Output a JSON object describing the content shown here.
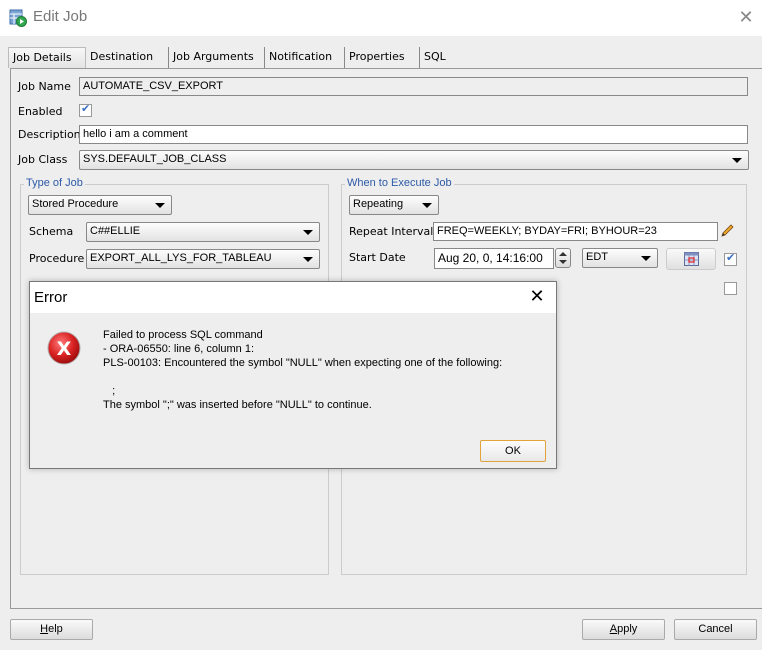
{
  "window": {
    "title": "Edit Job",
    "app_icon": "job-scheduler-icon",
    "close_icon": "close-icon"
  },
  "tabs": [
    {
      "label": "Job Details",
      "active": true
    },
    {
      "label": "Destination",
      "active": false
    },
    {
      "label": "Job Arguments",
      "active": false
    },
    {
      "label": "Notification",
      "active": false
    },
    {
      "label": "Properties",
      "active": false
    },
    {
      "label": "SQL",
      "active": false
    }
  ],
  "job_details": {
    "job_name_label": "Job Name",
    "job_name_value": "AUTOMATE_CSV_EXPORT",
    "enabled_label": "Enabled",
    "enabled_checked": true,
    "description_label": "Description",
    "description_value": "hello i am a comment",
    "job_class_label": "Job Class",
    "job_class_value": "SYS.DEFAULT_JOB_CLASS"
  },
  "type_of_job": {
    "title": "Type of Job",
    "type_value": "Stored Procedure",
    "schema_label": "Schema",
    "schema_value": "C##ELLIE",
    "procedure_label": "Procedure",
    "procedure_value": "EXPORT_ALL_LYS_FOR_TABLEAU"
  },
  "when_to_execute": {
    "title": "When to Execute Job",
    "mode_value": "Repeating",
    "repeat_interval_label": "Repeat Interval",
    "repeat_interval_value": "FREQ=WEEKLY; BYDAY=FRI; BYHOUR=23",
    "start_date_label": "Start Date",
    "start_date_value": "Aug 20, 0, 14:16:00",
    "timezone_value": "EDT",
    "start_date_checkbox_checked": true,
    "end_date_checkbox_checked": false
  },
  "error_dialog": {
    "title": "Error",
    "lines": [
      "Failed to process SQL command",
      "- ORA-06550: line 6, column 1:",
      "PLS-00103: Encountered the symbol \"NULL\" when expecting one of the following:",
      "",
      "   ;",
      "The symbol \";\" was inserted before \"NULL\" to continue."
    ],
    "ok_label": "OK"
  },
  "footer": {
    "help_label": "Help",
    "help_mnemonic": "H",
    "help_rest": "elp",
    "apply_label": "Apply",
    "apply_mnemonic": "A",
    "apply_rest": "pply",
    "cancel_label": "Cancel"
  },
  "colors": {
    "group_title": "#2d5aa8",
    "ok_focus_border": "#e3a33b",
    "error_red": "#d32f2f"
  }
}
